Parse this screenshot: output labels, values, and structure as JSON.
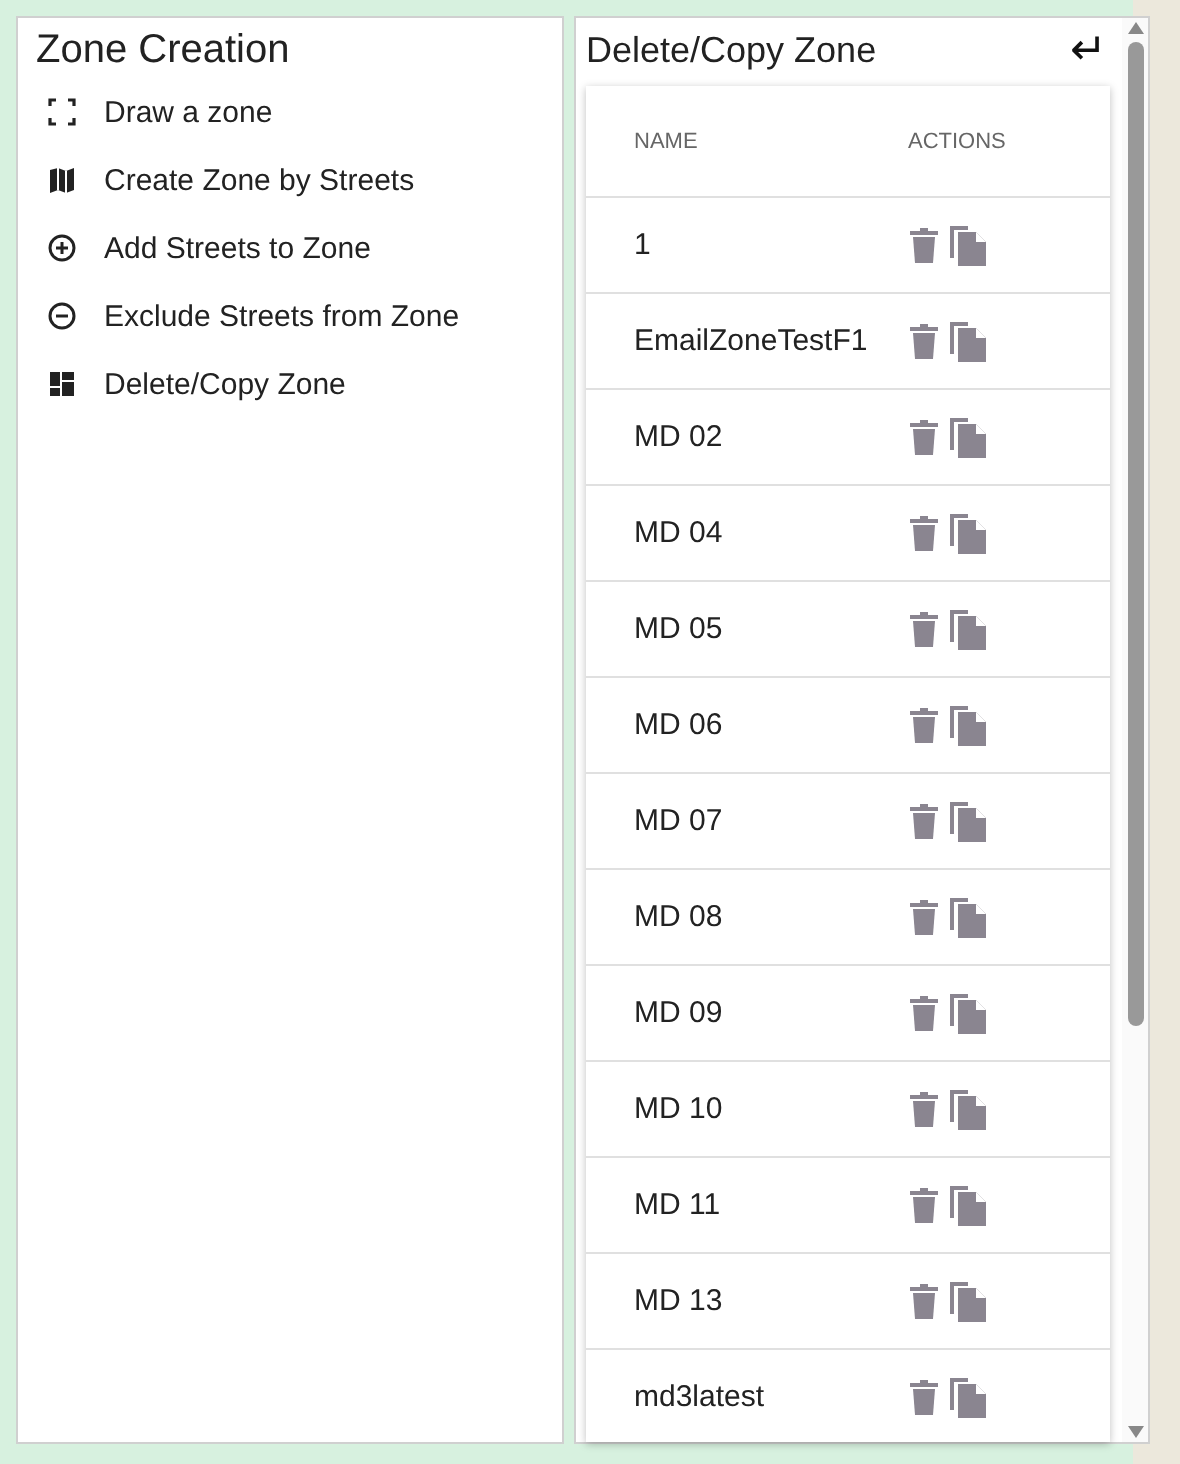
{
  "left_panel": {
    "title": "Zone Creation",
    "items": [
      {
        "kind": "draw",
        "label": "Draw a zone"
      },
      {
        "kind": "map",
        "label": "Create Zone by Streets"
      },
      {
        "kind": "add",
        "label": "Add Streets to Zone"
      },
      {
        "kind": "exclude",
        "label": "Exclude Streets from Zone"
      },
      {
        "kind": "dashboard",
        "label": "Delete/Copy Zone"
      }
    ]
  },
  "right_panel": {
    "title": "Delete/Copy Zone",
    "back_icon": "↵",
    "table": {
      "columns": [
        "NAME",
        "ACTIONS"
      ],
      "rows": [
        {
          "name": "1"
        },
        {
          "name": "EmailZoneTestF1"
        },
        {
          "name": "MD 02"
        },
        {
          "name": "MD 04"
        },
        {
          "name": "MD 05"
        },
        {
          "name": "MD 06"
        },
        {
          "name": "MD 07"
        },
        {
          "name": "MD 08"
        },
        {
          "name": "MD 09"
        },
        {
          "name": "MD 10"
        },
        {
          "name": "MD 11"
        },
        {
          "name": "MD 13"
        },
        {
          "name": "md3latest"
        }
      ]
    }
  }
}
